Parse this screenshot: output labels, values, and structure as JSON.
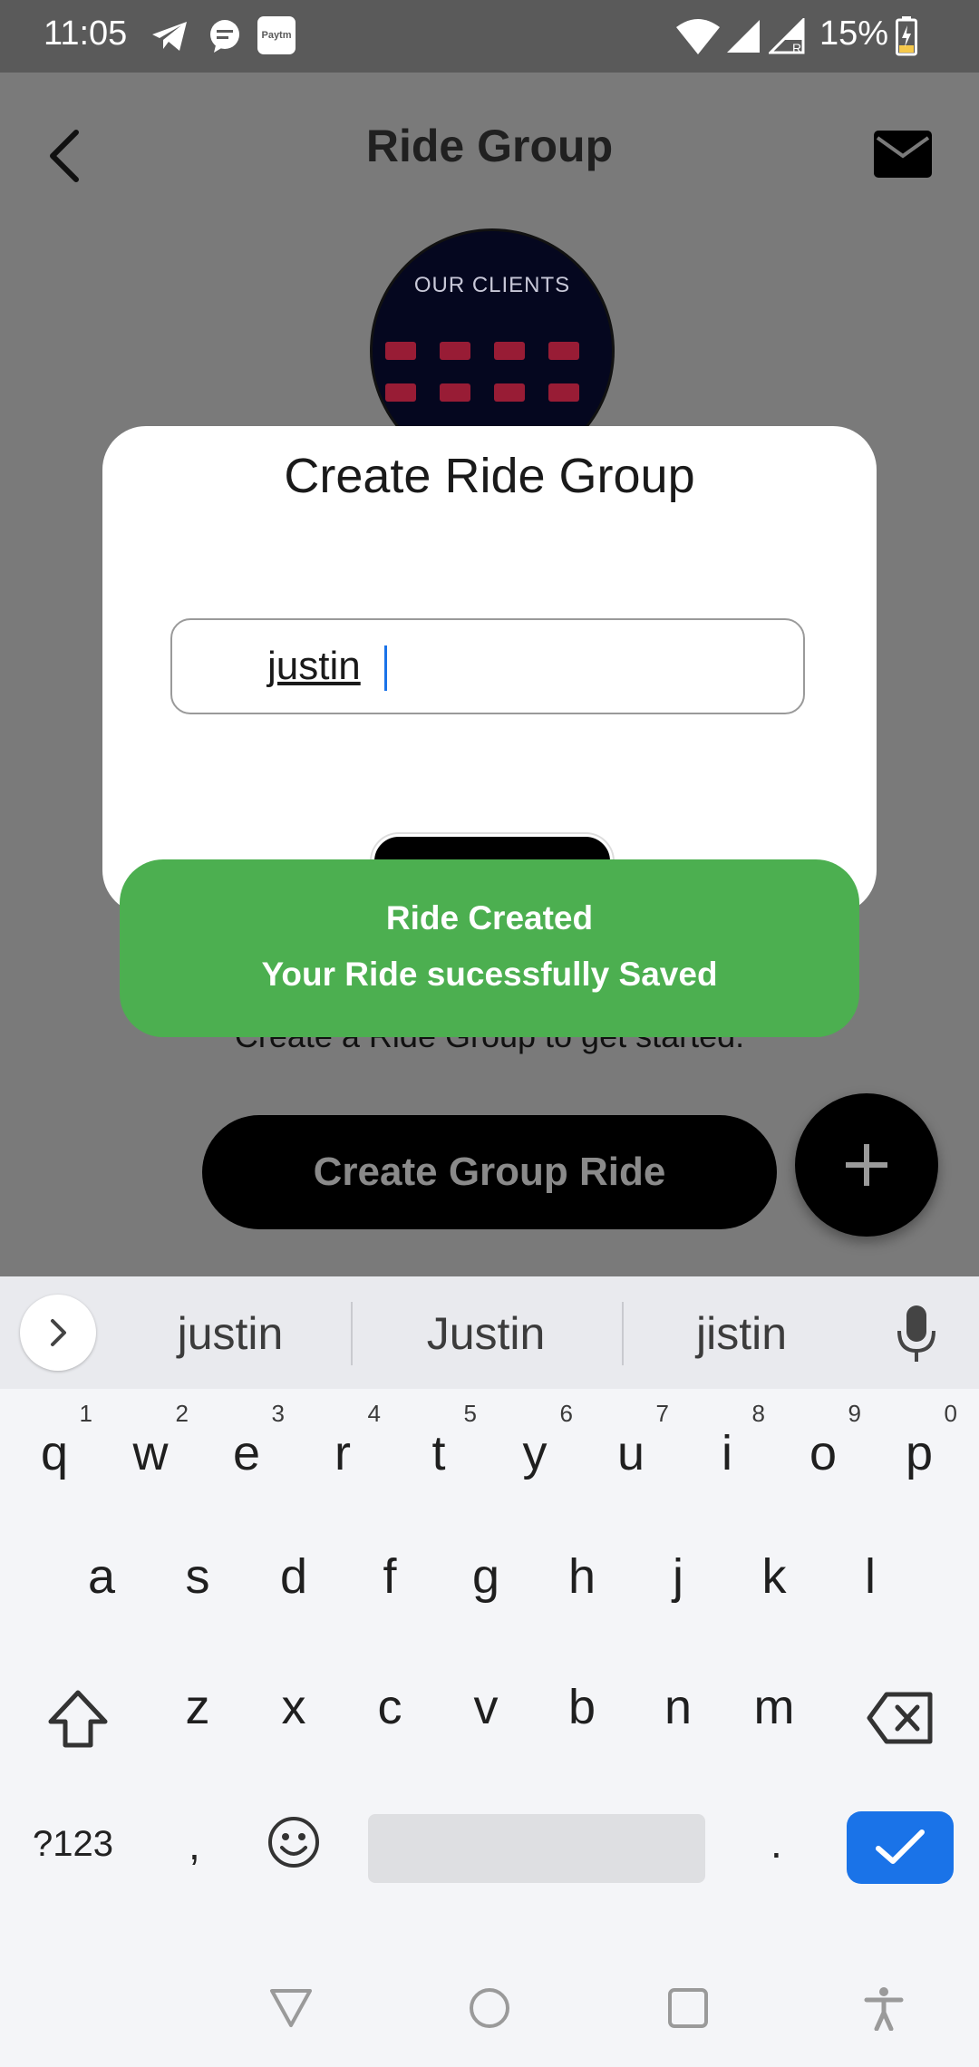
{
  "status_bar": {
    "time": "11:05",
    "battery": "15%",
    "icons": [
      "telegram-icon",
      "chat-icon",
      "paytm-icon",
      "wifi-icon",
      "signal-icon",
      "signal-r-icon",
      "battery-charging-icon"
    ],
    "paytm_label": "Paytm"
  },
  "header": {
    "title": "Ride Group",
    "back_icon": "back-arrow-icon",
    "mail_icon": "mail-icon"
  },
  "avatar": {
    "text": "OUR CLIENTS"
  },
  "main": {
    "empty_state_text": "Create a Ride Group to get started.",
    "create_button_label": "Create Group Ride",
    "fab_icon": "plus-icon"
  },
  "dialog": {
    "title": "Create Ride Group",
    "input_value": "justin"
  },
  "toast": {
    "title": "Ride Created",
    "message": "Your Ride sucessfully Saved",
    "color": "#4caf50"
  },
  "keyboard": {
    "suggestions": [
      "justin",
      "Justin",
      "jistin"
    ],
    "row1": [
      {
        "key": "q",
        "hint": "1"
      },
      {
        "key": "w",
        "hint": "2"
      },
      {
        "key": "e",
        "hint": "3"
      },
      {
        "key": "r",
        "hint": "4"
      },
      {
        "key": "t",
        "hint": "5"
      },
      {
        "key": "y",
        "hint": "6"
      },
      {
        "key": "u",
        "hint": "7"
      },
      {
        "key": "i",
        "hint": "8"
      },
      {
        "key": "o",
        "hint": "9"
      },
      {
        "key": "p",
        "hint": "0"
      }
    ],
    "row2": [
      "a",
      "s",
      "d",
      "f",
      "g",
      "h",
      "j",
      "k",
      "l"
    ],
    "row3": [
      "z",
      "x",
      "c",
      "v",
      "b",
      "n",
      "m"
    ],
    "symbols_label": "?123",
    "comma": ",",
    "period": ".",
    "accent_color": "#1a73e8"
  }
}
